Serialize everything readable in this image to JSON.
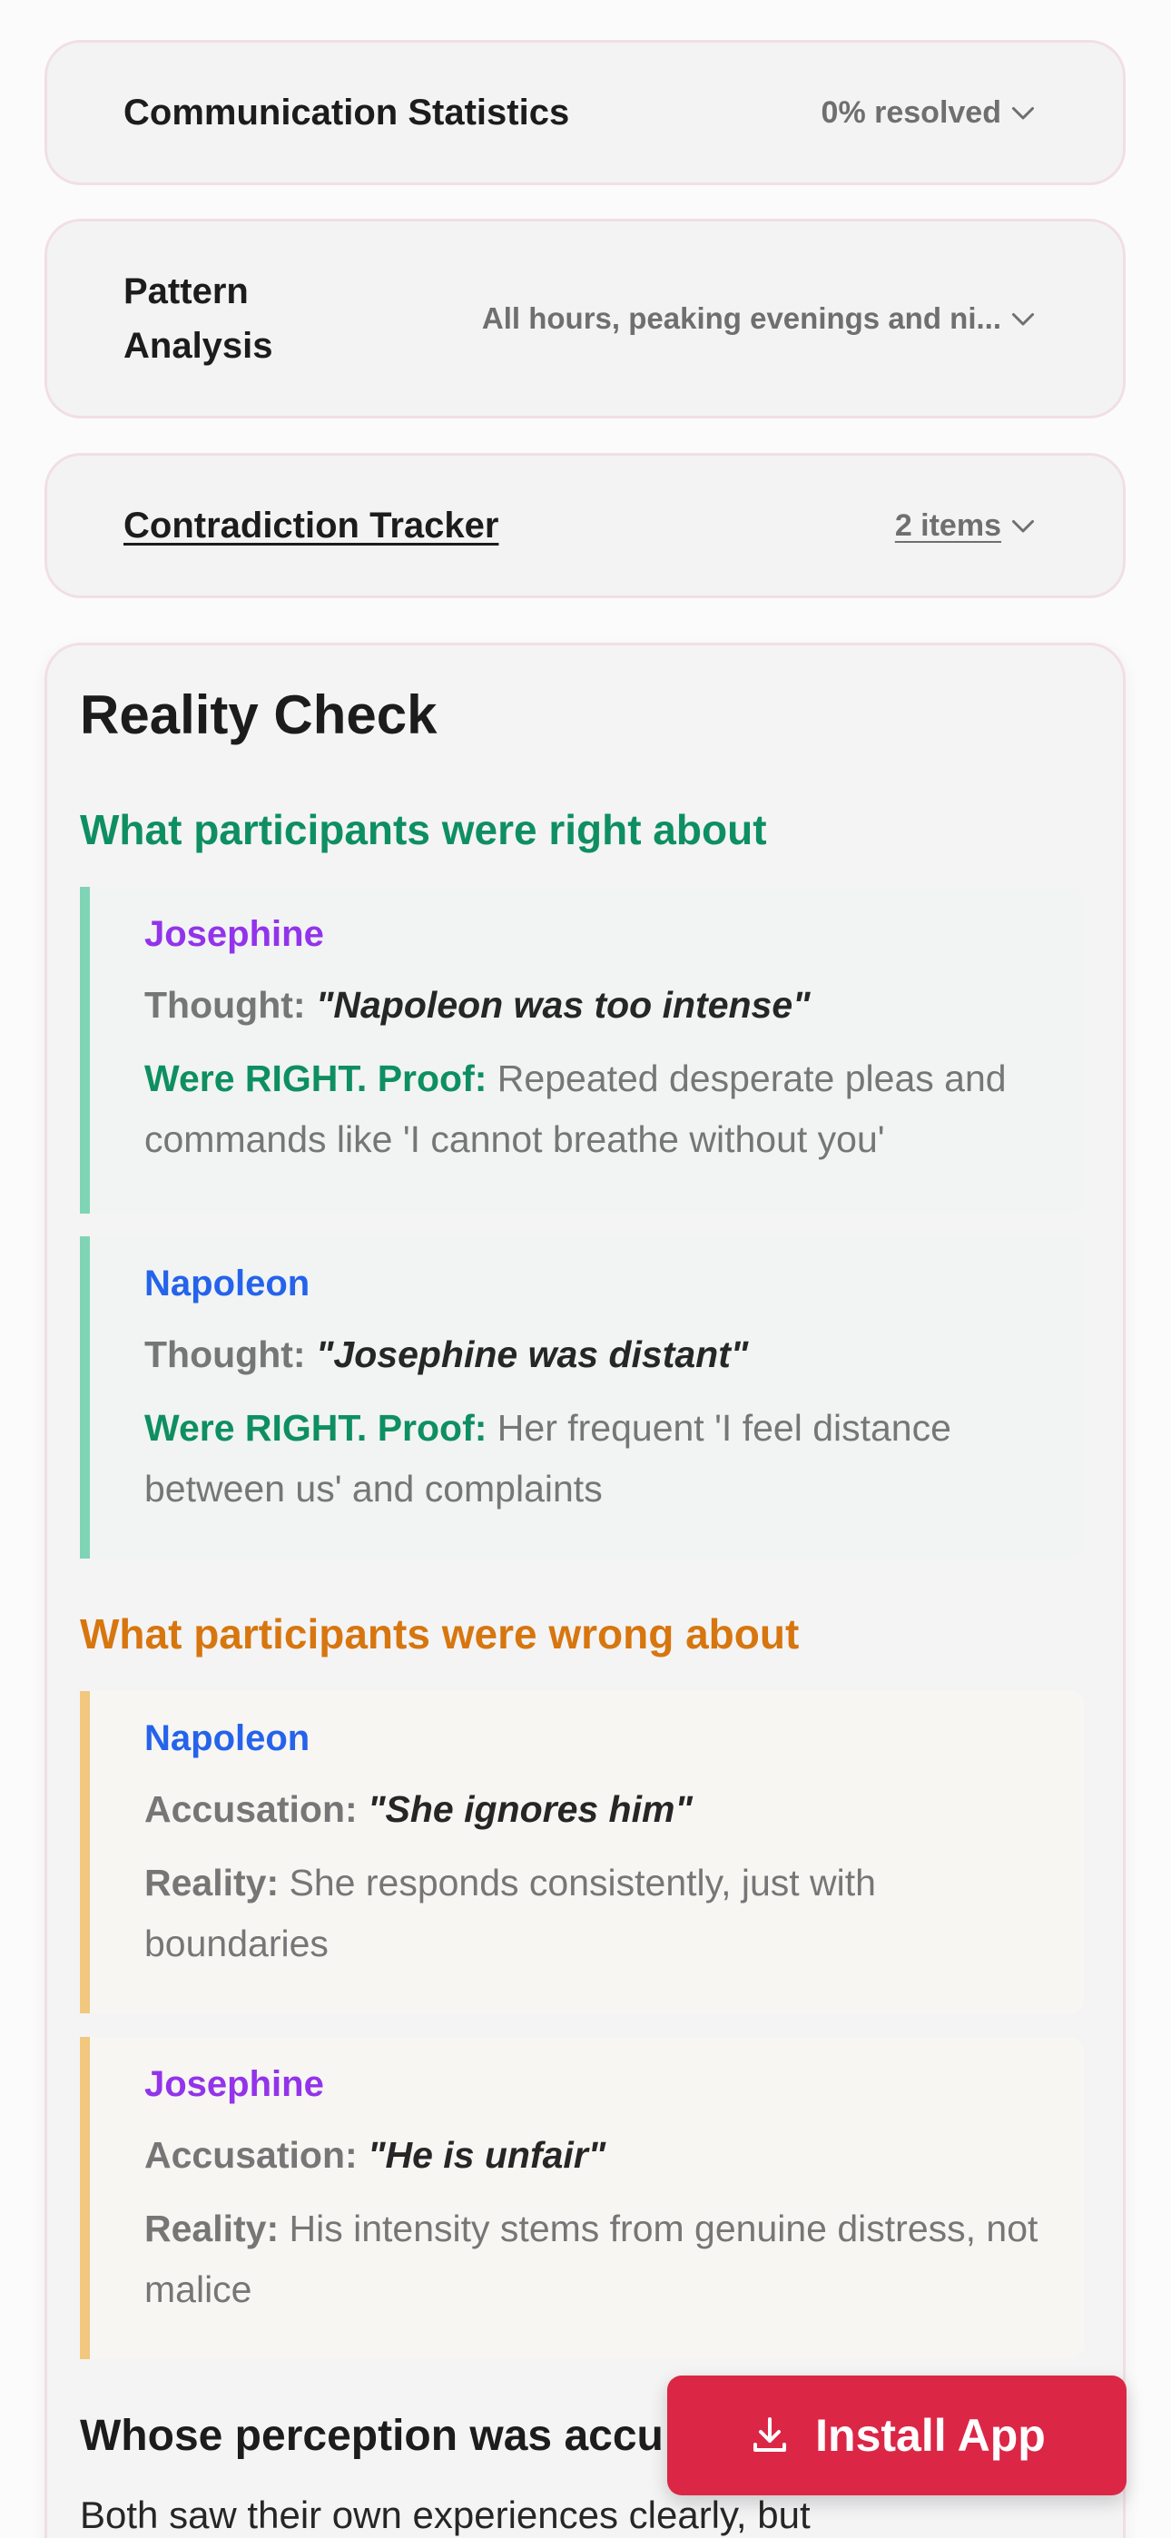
{
  "accordions": [
    {
      "title": "Communication Statistics",
      "value": "0% resolved"
    },
    {
      "title": "Pattern Analysis",
      "value": "All hours, peaking evenings and ni..."
    },
    {
      "title": "Contradiction Tracker",
      "value": "2 items"
    }
  ],
  "reality": {
    "title": "Reality Check",
    "right_heading": "What participants were right about",
    "right_items": [
      {
        "name": "Josephine",
        "thought_label": "Thought:",
        "thought": "\"Napoleon was too intense\"",
        "proof_label": "Were RIGHT. Proof:",
        "proof": "Repeated desperate pleas and commands like 'I cannot breathe without you'"
      },
      {
        "name": "Napoleon",
        "thought_label": "Thought:",
        "thought": "\"Josephine was distant\"",
        "proof_label": "Were RIGHT. Proof:",
        "proof": "Her frequent 'I feel distance between us' and complaints"
      }
    ],
    "wrong_heading": "What participants were wrong about",
    "wrong_items": [
      {
        "name": "Napoleon",
        "accusation_label": "Accusation:",
        "accusation": "\"She ignores him\"",
        "reality_label": "Reality:",
        "reality": "She responds consistently, just with boundaries"
      },
      {
        "name": "Josephine",
        "accusation_label": "Accusation:",
        "accusation": "\"He is unfair\"",
        "reality_label": "Reality:",
        "reality": "His intensity stems from genuine distress, not malice"
      }
    ],
    "whose_heading": "Whose perception was accu",
    "body_text": "Both saw their own experiences clearly, but"
  },
  "install_button": {
    "label": "Install App",
    "icon": "download-icon"
  },
  "colors": {
    "right": "#0e8f62",
    "wrong": "#d7760f",
    "josephine": "#9333ea",
    "napoleon": "#2563eb",
    "install": "#dc2646"
  }
}
